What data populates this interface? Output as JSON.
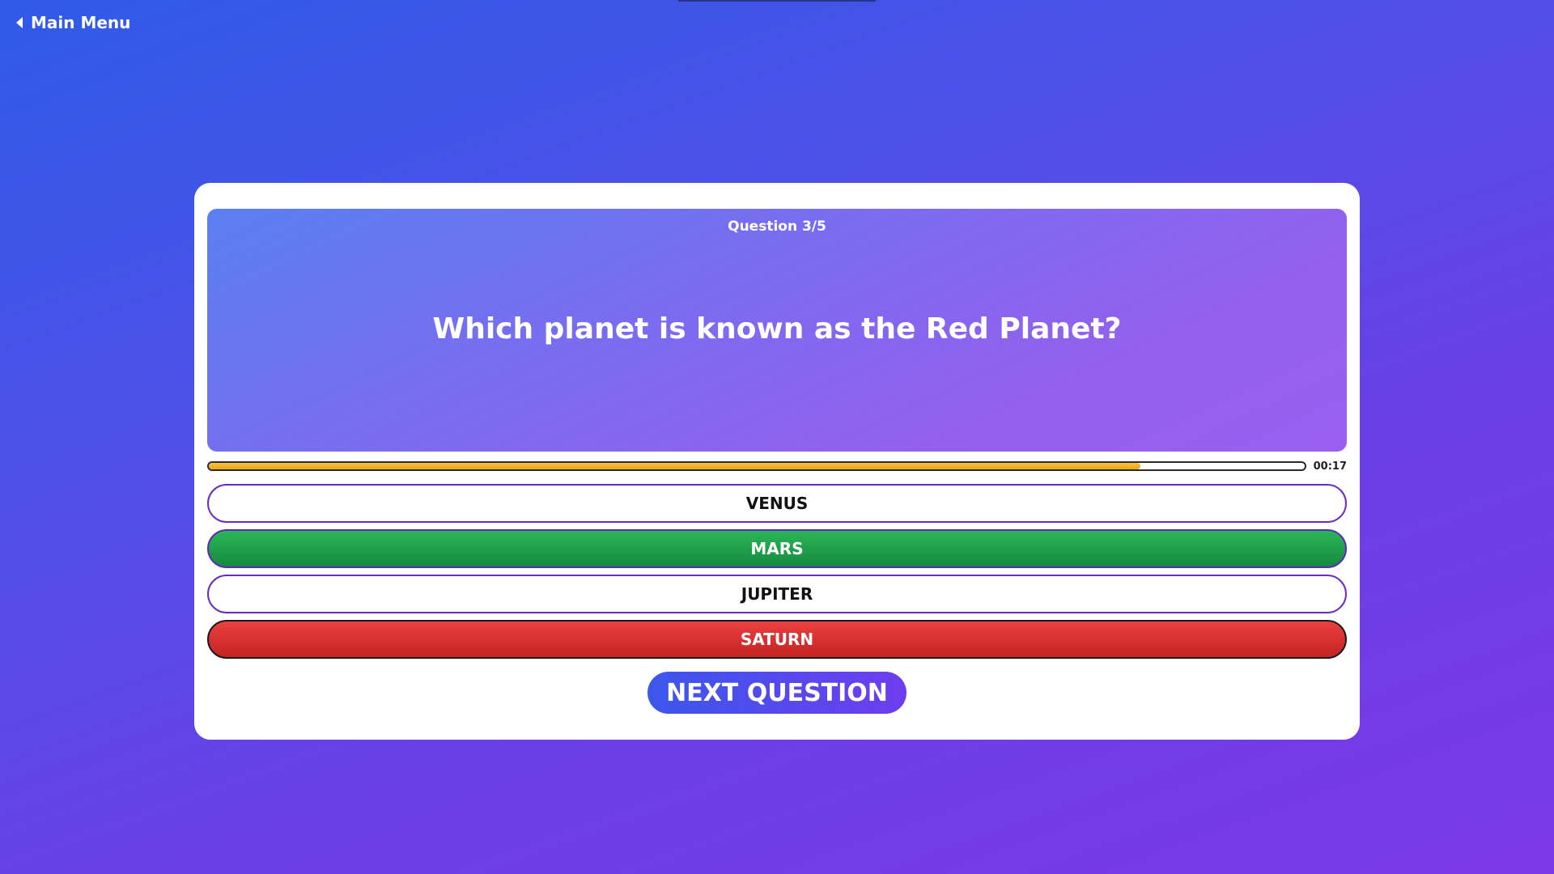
{
  "nav": {
    "back_label": "Main Menu",
    "back_icon": "chevron-left-icon"
  },
  "quiz": {
    "counter": "Question 3/5",
    "question": "Which planet is known as the Red Planet?",
    "timer": "00:17",
    "time_progress_percent": 85,
    "answers": [
      {
        "label": "VENUS",
        "state": "neutral"
      },
      {
        "label": "MARS",
        "state": "correct"
      },
      {
        "label": "JUPITER",
        "state": "neutral"
      },
      {
        "label": "SATURN",
        "state": "wrong"
      }
    ],
    "next_label": "NEXT QUESTION"
  },
  "colors": {
    "correct": "#1fa04a",
    "wrong": "#d63030",
    "progress": "#f2b62a",
    "accent": "#6a2cc4"
  }
}
